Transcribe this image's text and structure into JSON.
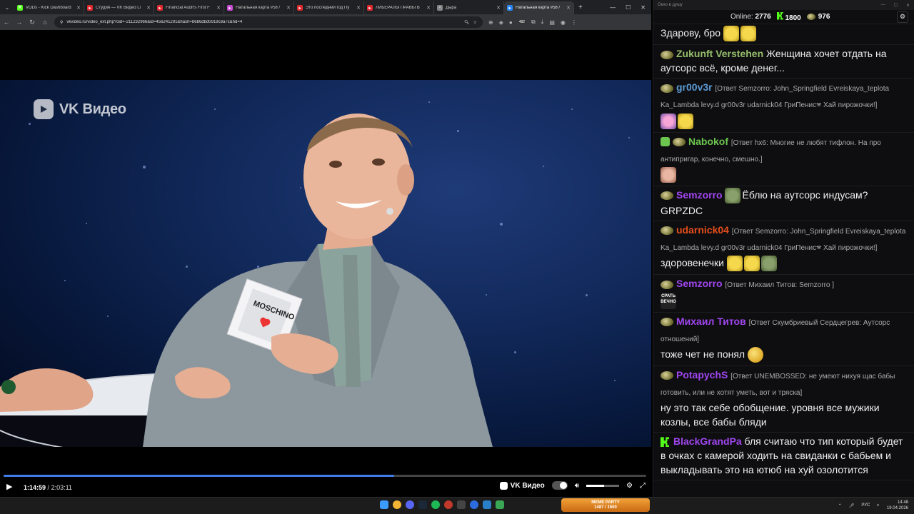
{
  "browser": {
    "tabs": [
      {
        "title": "VODs - Kick Dashboard",
        "color": "#53fc18",
        "glyph": "K"
      },
      {
        "title": "Студия — VK Видео Li",
        "color": "#e0282f",
        "glyph": "▸"
      },
      {
        "title": "Financial Audit's First F",
        "color": "#e0282f",
        "glyph": "▸"
      },
      {
        "title": "Натальная карта #58 /",
        "color": "#c94bd1",
        "glyph": "▸"
      },
      {
        "title": "Это последний год Пу",
        "color": "#e0282f",
        "glyph": "▸"
      },
      {
        "title": "ЛИБЕРАЛЫ ПРАВЫ В",
        "color": "#e0282f",
        "glyph": "▸"
      },
      {
        "title": "Дыра",
        "color": "#888888",
        "glyph": "▫"
      },
      {
        "title": "Натальная карта #58 /",
        "color": "#2787f5",
        "glyph": "▸"
      }
    ],
    "active_tab_index": 7,
    "url": "vkvideo.ru/video_ext.php?oid=-211232966&id=456241291&hash=b6b6dbd0919c8a7c&hd=4",
    "badge_count": "482"
  },
  "video": {
    "watermark": "VK Видео",
    "current_time": "1:14:59",
    "duration": "2:03:11",
    "progress_fraction": 0.608,
    "volume_fraction": 0.55,
    "brand_label": "VK Видео"
  },
  "chat": {
    "window_title": "Окно в душу",
    "online_label": "Online:",
    "online_count": "2776",
    "followers": "1800",
    "coins": "976"
  },
  "messages": [
    {
      "user": "",
      "color": "#ffffff",
      "reply": "",
      "text": "Здарову, бро",
      "emotes": [
        "yel",
        "yel"
      ]
    },
    {
      "user": "Zukunft Verstehen",
      "color": "#96bf6c",
      "reply": "",
      "text": "Женщина хочет отдать на аутсорс всё, кроме денег...",
      "emotes": []
    },
    {
      "user": "gr00v3r",
      "color": "#5b9bd5",
      "reply": "[Ответ Semzorro: John_Springfield Evreiskaya_teplota Ka_Lambda levy.d gr00v3r udarnick04 ГриПенис🕿 Хай пирожочки!]",
      "text": "",
      "emotes": [
        "pink",
        "yel"
      ]
    },
    {
      "user": "Nabokof",
      "color": "#6cc54f",
      "reply": "[Ответ hx6: Многие не любят тифлон. На про антипригар, конечно, смешно.]",
      "text": "",
      "emotes": [
        "face"
      ]
    },
    {
      "user": "Semzorro",
      "color": "#a046f0",
      "reply": "",
      "text": "Ёблю на аутсорс индусам? GRPZDC",
      "emotes": [
        "turtle"
      ]
    },
    {
      "user": "udarnick04",
      "color": "#e84e1c",
      "reply": "[Ответ Semzorro: John_Springfield Evreiskaya_teplota Ka_Lambda levy.d gr00v3r udarnick04 ГриПенис🕿 Хай пирожочки!]",
      "text": "здоровенечки",
      "emotes": [
        "yel",
        "yel",
        "turtle"
      ]
    },
    {
      "user": "Semzorro",
      "color": "#a046f0",
      "reply": "[Ответ Михаил Титов: Semzorro ]",
      "text": "",
      "emotes": [
        "text"
      ],
      "emote_text": "СРАТЬ ВЕЧНО"
    },
    {
      "user": "Михаил Титов",
      "color": "#a046f0",
      "reply": "[Ответ Скумбриевый Сердцегрев: Аутсорс отношений]",
      "text": "тоже чет не понял",
      "emotes": [
        "think"
      ]
    },
    {
      "user": "PotapychS",
      "color": "#a046f0",
      "reply": "[Ответ UNEMBOSSED: не умеют нихуя щас бабы готовить, или не хотят уметь, вот и тряска]",
      "text": "ну это так себе обобщение. уровня все мужики козлы, все бабы бляди",
      "emotes": []
    },
    {
      "user": "BlackGrandPa",
      "color": "#a046f0",
      "reply": "",
      "text": "бля считаю что тип который будет в очках с камерой ходить на свиданки с бабьем и выкладывать это на ютюб на хуй озолотится",
      "emotes": []
    }
  ],
  "taskbar": {
    "widget_title": "MEME PARTY",
    "widget_values": "1487 / 1500",
    "lang": "РУС",
    "time": "14:48",
    "date": "19.04.2026"
  }
}
